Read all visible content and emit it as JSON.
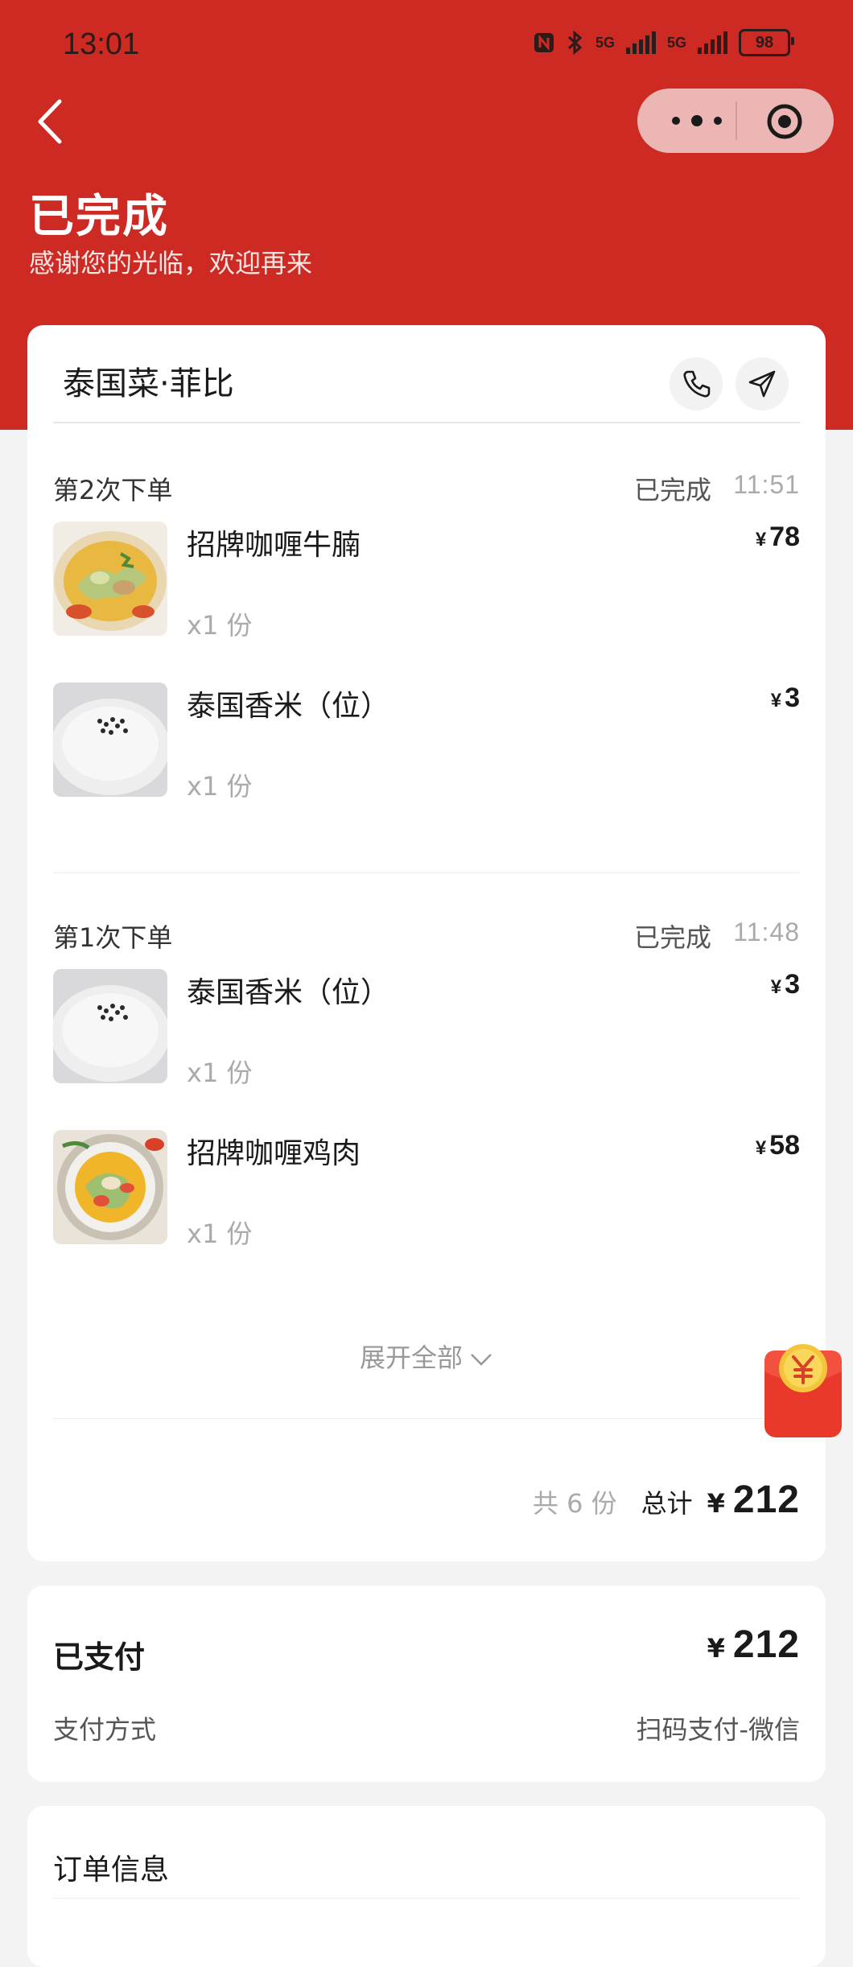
{
  "status_bar": {
    "time": "13:01",
    "battery": "98",
    "network_1": "5G",
    "network_2": "5G"
  },
  "header": {
    "title": "已完成",
    "subtitle": "感谢您的光临，欢迎再来"
  },
  "colors": {
    "brand_red": "#cc2a22",
    "capsule": "#ebb6b3"
  },
  "restaurant": {
    "name": "泰国菜·菲比"
  },
  "orders": [
    {
      "label": "第2次下单",
      "status": "已完成",
      "time": "11:51",
      "items": [
        {
          "name": "招牌咖喱牛腩",
          "price": "78",
          "qty": "x1 份",
          "image": "curry-beef-photo"
        },
        {
          "name": "泰国香米（位）",
          "price": "3",
          "qty": "x1 份",
          "image": "rice-photo"
        }
      ]
    },
    {
      "label": "第1次下单",
      "status": "已完成",
      "time": "11:48",
      "items": [
        {
          "name": "泰国香米（位）",
          "price": "3",
          "qty": "x1 份",
          "image": "rice-photo"
        },
        {
          "name": "招牌咖喱鸡肉",
          "price": "58",
          "qty": "x1 份",
          "image": "curry-chicken-photo"
        }
      ]
    }
  ],
  "currency": "¥",
  "expand_label": "展开全部",
  "summary": {
    "count": "共 6 份",
    "total_label": "总计",
    "total": "212"
  },
  "payment": {
    "label": "已支付",
    "amount": "212",
    "method_label": "支付方式",
    "method_value": "扫码支付-微信"
  },
  "order_info": {
    "title": "订单信息"
  },
  "icons": [
    "back-arrow-icon",
    "more-dots-icon",
    "close-target-icon",
    "phone-icon",
    "navigation-icon",
    "chevron-down-icon",
    "red-packet-icon"
  ]
}
